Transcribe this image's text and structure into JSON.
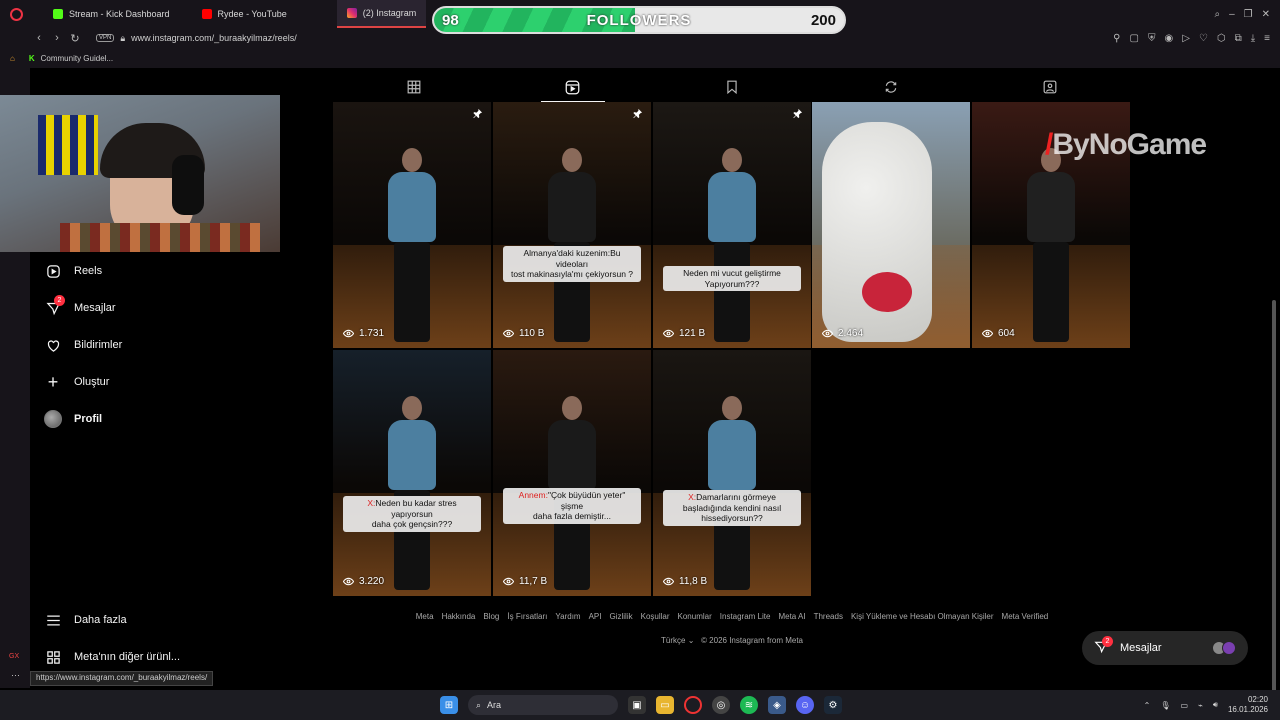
{
  "browser": {
    "tabs": [
      {
        "label": "Stream - Kick Dashboard",
        "icon": "kick-icon",
        "color": "#53fc18"
      },
      {
        "label": "Rydee - YouTube",
        "icon": "youtube-icon",
        "color": "#ff0000"
      },
      {
        "label": "(2) Instagram",
        "icon": "instagram-icon",
        "color": "#e1306c"
      }
    ],
    "vpn_label": "VPN",
    "url": "www.instagram.com/_buraakyilmaz/reels/",
    "bookmark": "Community Guidel..."
  },
  "overlay": {
    "followers_label": "FOLLOWERS",
    "current": "98",
    "goal": "200",
    "progress_fraction": 0.49,
    "watermark_brand": "ByNoGame"
  },
  "sidebar": {
    "items": [
      {
        "label": "Reels",
        "icon": "reels-icon"
      },
      {
        "label": "Mesajlar",
        "icon": "messenger-icon",
        "badge": "2"
      },
      {
        "label": "Bildirimler",
        "icon": "heart-icon"
      },
      {
        "label": "Oluştur",
        "icon": "plus-icon"
      },
      {
        "label": "Profil",
        "icon": "avatar"
      }
    ],
    "bottom_items": [
      {
        "label": "Daha fazla",
        "icon": "menu-icon"
      },
      {
        "label": "Meta'nın diğer ürünl...",
        "icon": "meta-apps-icon"
      }
    ]
  },
  "profile_tabs": [
    {
      "name": "posts",
      "icon": "grid-icon"
    },
    {
      "name": "reels",
      "icon": "reels-icon",
      "active": true
    },
    {
      "name": "saved",
      "icon": "bookmark-icon"
    },
    {
      "name": "reposts",
      "icon": "repost-icon"
    },
    {
      "name": "tagged",
      "icon": "tagged-icon"
    }
  ],
  "reels": [
    {
      "views": "1.731",
      "pinned": true,
      "caption": "",
      "torso": "#4c7fa0",
      "bg": "#1a1410"
    },
    {
      "views": "110 B",
      "pinned": true,
      "caption": "Almanya'daki kuzenim:Bu videoları\ntost makinasıyla'mı çekiyorsun ?",
      "caption_prefix": "",
      "torso": "#1a1a1a",
      "bg": "#2a1c10"
    },
    {
      "views": "121 B",
      "pinned": true,
      "caption": "Neden mi vucut geliştirme\nYapıyorum???",
      "caption_prefix": "",
      "torso": "#4c7fa0",
      "bg": "#1c1814"
    },
    {
      "views": "2.464",
      "pinned": false,
      "caption": "",
      "animal": true,
      "bg": "#6a7a88"
    },
    {
      "views": "604",
      "pinned": false,
      "caption": "",
      "torso": "#202020",
      "bg": "#3a1a14"
    },
    {
      "views": "3.220",
      "pinned": false,
      "caption": "Neden bu kadar stres yapıyorsun\ndaha çok gençsin???",
      "caption_prefix": "X:",
      "torso": "#4c7fa0",
      "bg": "#16202a"
    },
    {
      "views": "11,7 B",
      "pinned": false,
      "caption": "\"Çok büyüdün yeter\" şişme\ndaha fazla demiştir...",
      "caption_prefix": "Annem:",
      "torso": "#1a1a1a",
      "bg": "#2a1a10"
    },
    {
      "views": "11,8 B",
      "pinned": false,
      "caption": "Damarlarını görmeye\nbaşladığında kendini nasıl\nhissediyorsun??",
      "caption_prefix": "X:",
      "torso": "#4c7fa0",
      "bg": "#1a1612"
    }
  ],
  "footer": {
    "links": [
      "Meta",
      "Hakkında",
      "Blog",
      "İş Fırsatları",
      "Yardım",
      "API",
      "Gizlilik",
      "Koşullar",
      "Konumlar",
      "Instagram Lite",
      "Meta AI",
      "Threads",
      "Kişi Yükleme ve Hesabı Olmayan Kişiler",
      "Meta Verified"
    ],
    "language": "Türkçe",
    "copyright": "© 2026 Instagram from Meta"
  },
  "messages_bubble": {
    "label": "Mesajlar",
    "badge": "2"
  },
  "status_url": "https://www.instagram.com/_buraakyilmaz/reels/",
  "taskbar": {
    "search_label": "Ara",
    "time": "02:20",
    "date": "16.01.2026"
  }
}
